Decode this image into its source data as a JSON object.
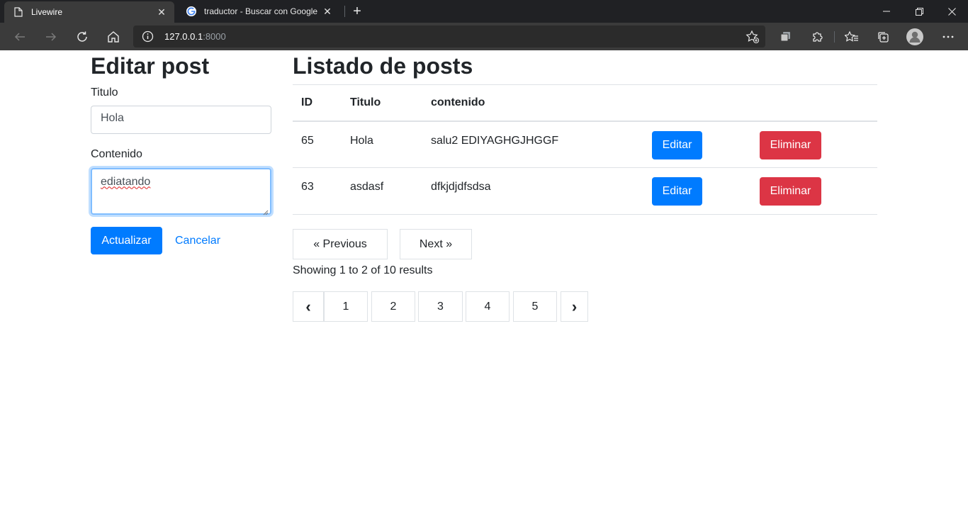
{
  "browser": {
    "tabs": [
      {
        "title": "Livewire",
        "active": true,
        "icon": "page-icon"
      },
      {
        "title": "traductor - Buscar con Google",
        "active": false,
        "icon": "google-icon"
      }
    ],
    "url": {
      "host": "127.0.0.1",
      "port": ":8000"
    }
  },
  "form": {
    "heading": "Editar post",
    "title_label": "Titulo",
    "title_value": "Hola",
    "content_label": "Contenido",
    "content_value": "ediatando",
    "submit_label": "Actualizar",
    "cancel_label": "Cancelar"
  },
  "list": {
    "heading": "Listado de posts",
    "columns": [
      "ID",
      "Titulo",
      "contenido"
    ],
    "rows": [
      {
        "id": "65",
        "title": "Hola",
        "content": "salu2 EDIYAGHGJHGGF",
        "edit": "Editar",
        "delete": "Eliminar"
      },
      {
        "id": "63",
        "title": "asdasf",
        "content": "dfkjdjdfsdsa",
        "edit": "Editar",
        "delete": "Eliminar"
      }
    ]
  },
  "pagination": {
    "previous": "« Previous",
    "next": "Next »",
    "summary": "Showing 1 to 2 of 10 results",
    "prev_arrow": "‹",
    "next_arrow": "›",
    "pages": [
      "1",
      "2",
      "3",
      "4",
      "5"
    ]
  },
  "colors": {
    "primary": "#007bff",
    "danger": "#dc3545"
  }
}
